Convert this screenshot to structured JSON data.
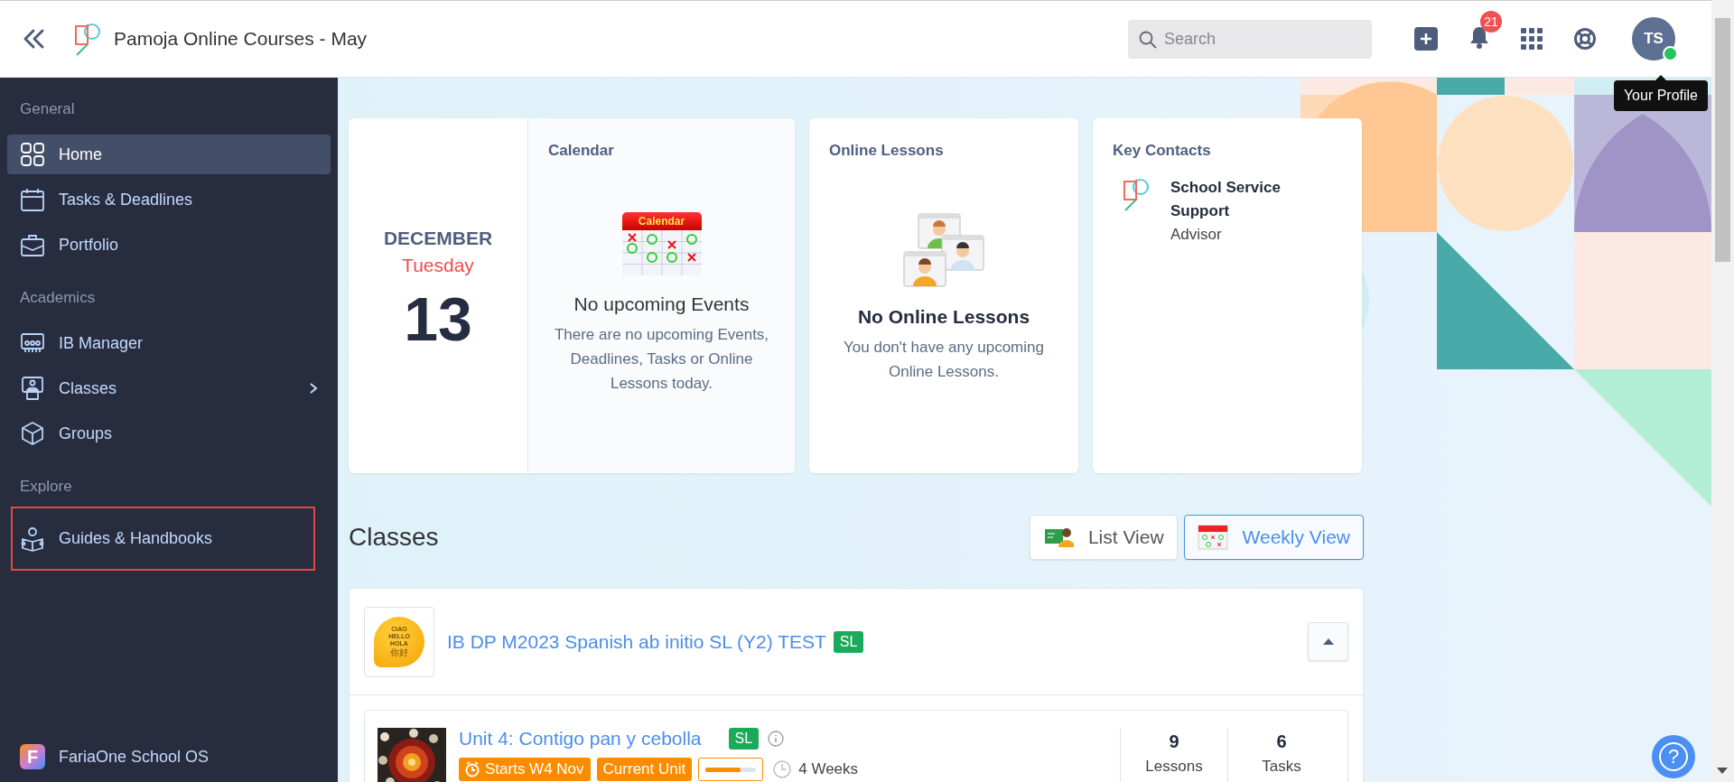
{
  "header": {
    "title": "Pamoja Online Courses - May",
    "search": {
      "placeholder": "Search"
    },
    "notifications": {
      "count": "21"
    },
    "profile": {
      "initials": "TS",
      "online": true
    },
    "tooltip": "Your Profile"
  },
  "sidebar": {
    "sections": [
      {
        "heading": "General",
        "items": [
          {
            "label": "Home",
            "selected": true,
            "expandable": false,
            "outlined": false
          },
          {
            "label": "Tasks & Deadlines",
            "selected": false,
            "expandable": false,
            "outlined": false
          },
          {
            "label": "Portfolio",
            "selected": false,
            "expandable": false,
            "outlined": false
          }
        ]
      },
      {
        "heading": "Academics",
        "items": [
          {
            "label": "IB Manager",
            "selected": false,
            "expandable": false,
            "outlined": false
          },
          {
            "label": "Classes",
            "selected": false,
            "expandable": true,
            "outlined": false
          },
          {
            "label": "Groups",
            "selected": false,
            "expandable": false,
            "outlined": false
          }
        ]
      },
      {
        "heading": "Explore",
        "items": [
          {
            "label": "Guides & Handbooks",
            "selected": false,
            "expandable": false,
            "outlined": true
          }
        ]
      }
    ],
    "footer": {
      "logo_letter": "F",
      "label": "FariaOne School OS"
    }
  },
  "date_card": {
    "month": "DECEMBER",
    "weekday": "Tuesday",
    "day": "13"
  },
  "calendar_card": {
    "title": "Calendar",
    "illustration_label": "Calendar",
    "empty_title": "No upcoming Events",
    "empty_text": "There are no upcoming Events, Deadlines, Tasks or Online Lessons today."
  },
  "online_lessons_card": {
    "title": "Online Lessons",
    "empty_title": "No Online Lessons",
    "empty_text": "You don't have any upcoming Online Lessons."
  },
  "key_contacts_card": {
    "title": "Key Contacts",
    "contacts": [
      {
        "name": "School Service Support",
        "role": "Advisor"
      }
    ]
  },
  "classes": {
    "title": "Classes",
    "view_buttons": [
      {
        "label": "List View",
        "selected": false
      },
      {
        "label": "Weekly View",
        "selected": true
      }
    ],
    "groups": [
      {
        "name": "IB DP M2023 Spanish ab initio SL (Y2) TEST",
        "level_badge": "SL",
        "expanded": true,
        "logo_words": [
          "CIAO",
          "HELLO",
          "HOLA",
          "你好"
        ],
        "units": [
          {
            "title": "Unit 4: Contigo pan y cebolla",
            "level_badge": "SL",
            "tags": [
              {
                "kind": "date",
                "text": "Starts W4 Nov"
              },
              {
                "kind": "status",
                "text": "Current Unit"
              }
            ],
            "level": 0.7,
            "duration": "4 Weeks",
            "stats": [
              {
                "value": "9",
                "label": "Lessons"
              },
              {
                "value": "6",
                "label": "Tasks"
              }
            ]
          }
        ]
      }
    ]
  },
  "help_button": {
    "label": "?"
  }
}
